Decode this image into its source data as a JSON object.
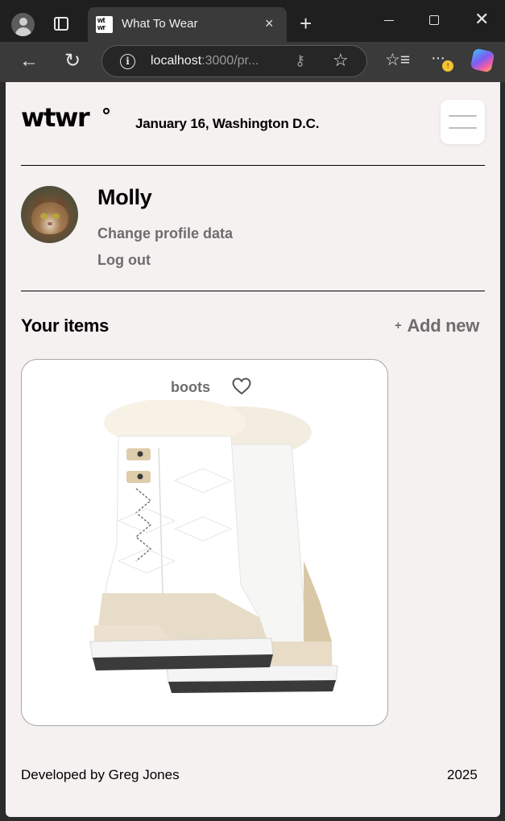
{
  "browser": {
    "tab_title": "What To Wear",
    "favicon_text": "wt wr",
    "tab_close_glyph": "×",
    "new_tab_glyph": "+",
    "window_close_glyph": "✕",
    "url_host": "localhost",
    "url_rest": ":3000/pr...",
    "back_glyph": "←",
    "reload_glyph": "↻",
    "info_glyph": "i",
    "key_glyph": "⚷",
    "star_glyph": "☆",
    "favorites_glyph": "☆≡",
    "more_glyph": "···",
    "update_badge": "↑",
    "icons": [
      "profile-icon",
      "tab-actions-icon",
      "site-info-icon",
      "key-icon",
      "favorite-star-icon",
      "favorites-icon",
      "more-icon",
      "copilot-icon"
    ]
  },
  "header": {
    "logo": "wtwr",
    "date_location": "January 16, Washington D.C.",
    "menu_icon": "hamburger-icon"
  },
  "profile": {
    "name": "Molly",
    "change_profile": "Change profile data",
    "logout": "Log out",
    "avatar_icon": "cat-avatar"
  },
  "items": {
    "title": "Your items",
    "add_new_plus": "+",
    "add_new": "Add new",
    "cards": [
      {
        "name": "boots",
        "liked": false,
        "image": "white-snow-boots"
      }
    ]
  },
  "footer": {
    "developer": "Developed by Greg Jones",
    "year": "2025"
  },
  "colors": {
    "page_bg": "#f5f1f1",
    "muted_text": "#6d6d6d",
    "card_border": "#a8a8a8",
    "chrome_dark": "#1f1f1f",
    "chrome_toolbar": "#3a3a3a"
  }
}
